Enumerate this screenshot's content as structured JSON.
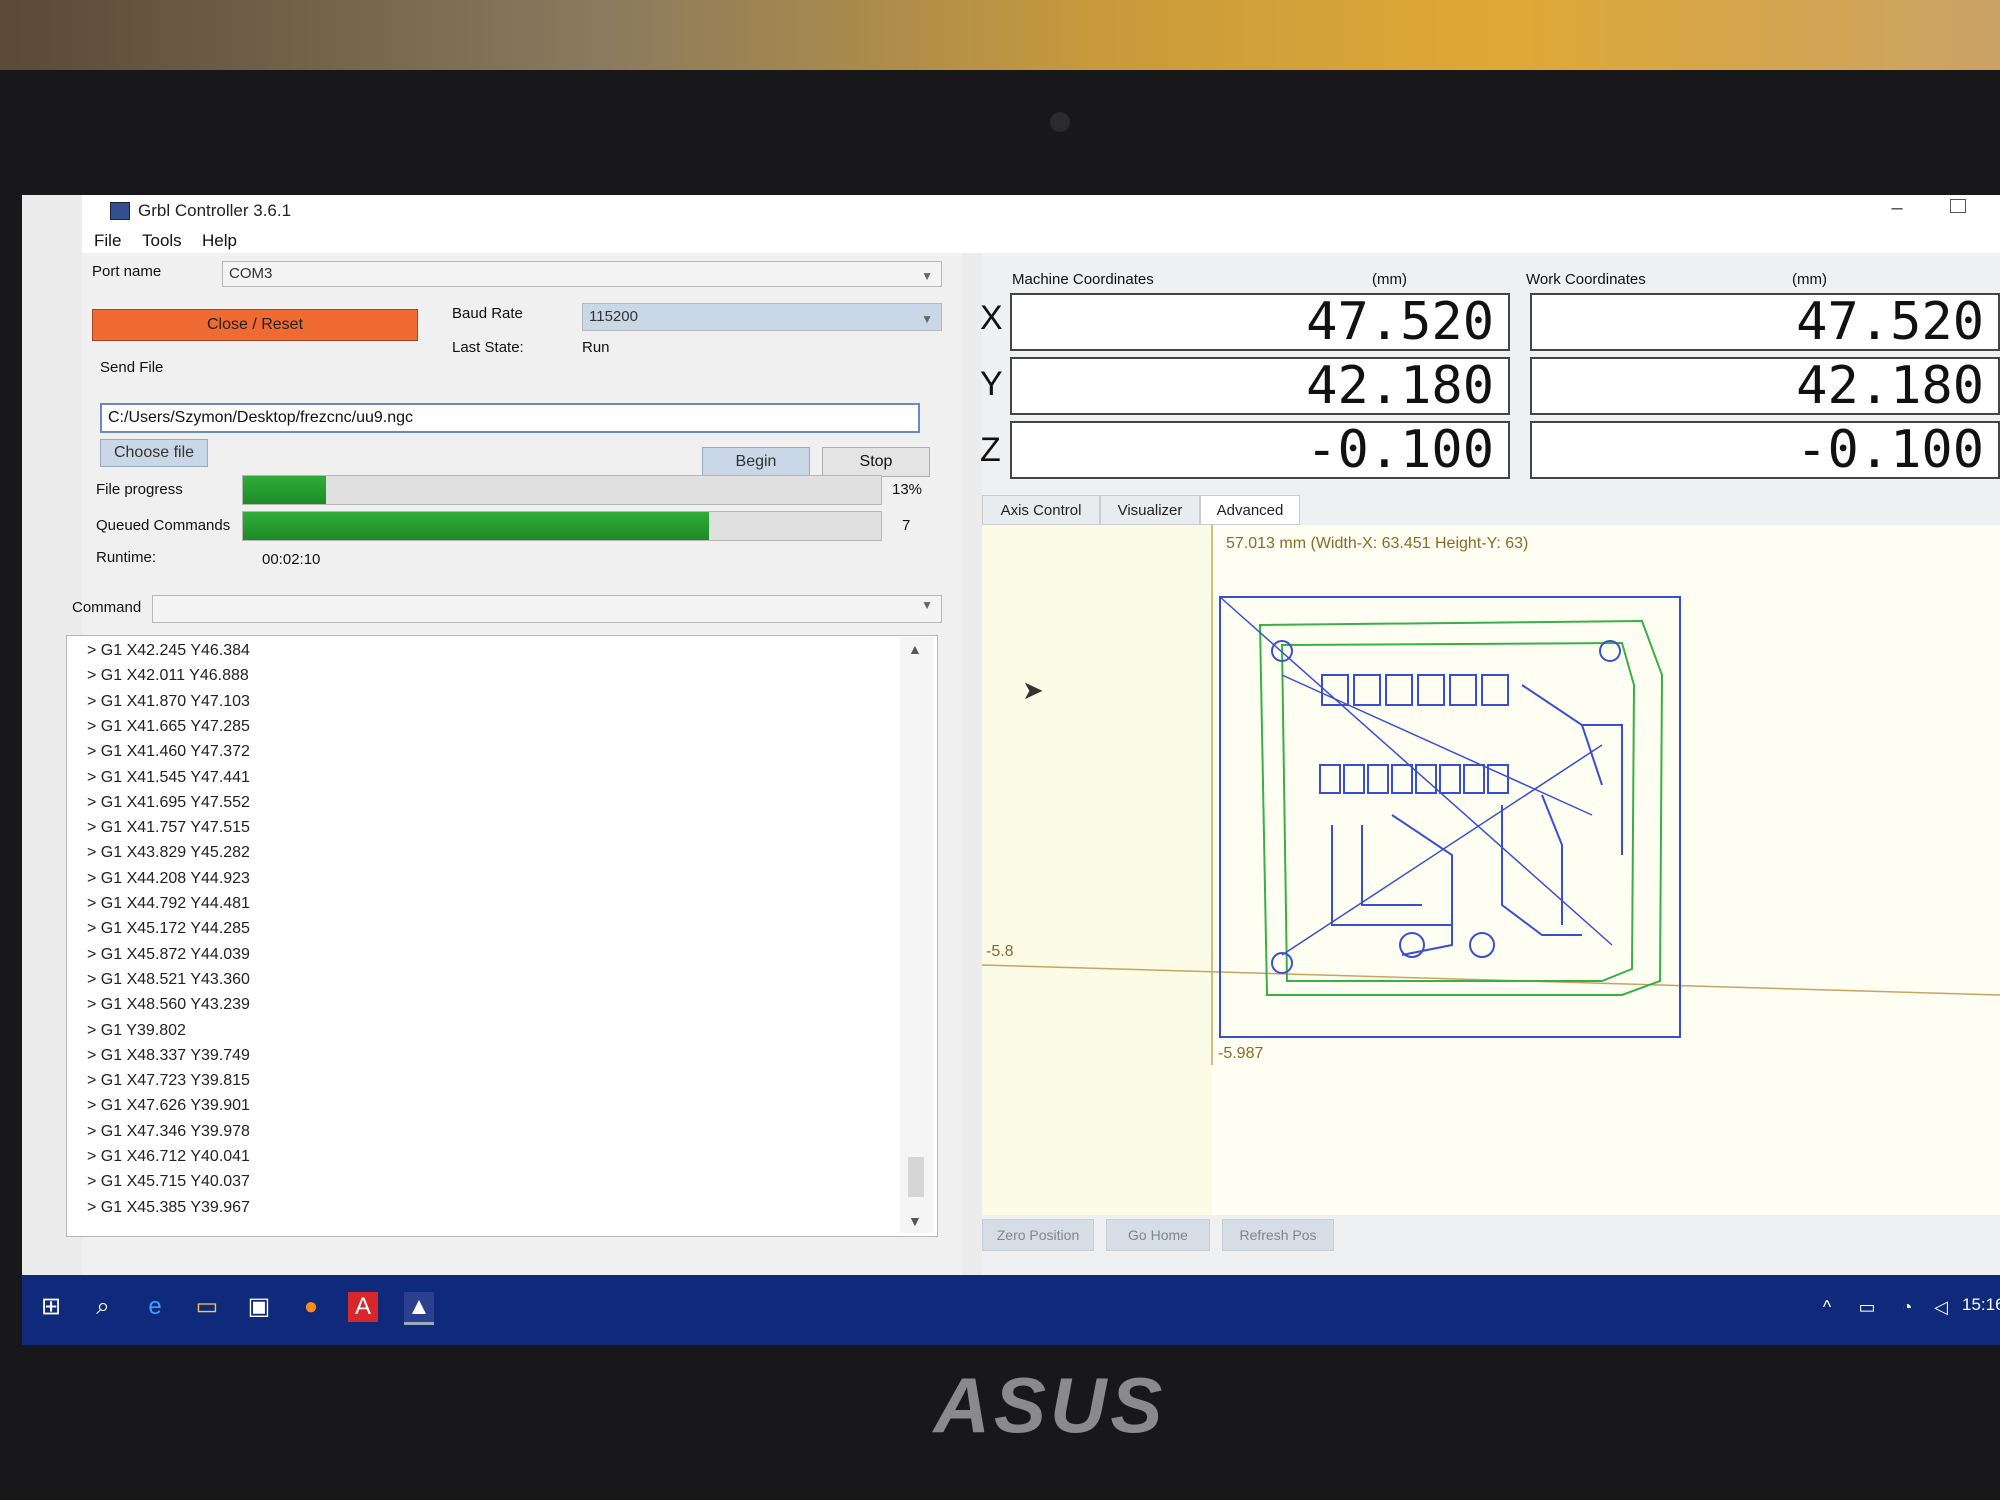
{
  "window": {
    "title": "Grbl Controller 3.6.1"
  },
  "menu": [
    "File",
    "Tools",
    "Help"
  ],
  "connection": {
    "port_label": "Port name",
    "port_value": "COM3",
    "close_button": "Close / Reset",
    "baud_label": "Baud Rate",
    "baud_value": "115200",
    "last_state_label": "Last State:",
    "last_state_value": "Run"
  },
  "send_file": {
    "label": "Send File",
    "path": "C:/Users/Szymon/Desktop/frezcnc/uu9.ngc",
    "choose_button": "Choose file",
    "begin_button": "Begin",
    "stop_button": "Stop",
    "file_progress_label": "File progress",
    "file_progress_percent": 13,
    "file_progress_text": "13%",
    "queued_label": "Queued Commands",
    "queued_fraction": 0.73,
    "queued_count": "7",
    "runtime_label": "Runtime:",
    "runtime_value": "00:02:10"
  },
  "command": {
    "label": "Command"
  },
  "log": [
    "> G1 X42.245 Y46.384",
    "> G1 X42.011 Y46.888",
    "> G1 X41.870 Y47.103",
    "> G1 X41.665 Y47.285",
    "> G1 X41.460 Y47.372",
    "> G1 X41.545 Y47.441",
    "> G1 X41.695 Y47.552",
    "> G1 X41.757 Y47.515",
    "> G1 X43.829 Y45.282",
    "> G1 X44.208 Y44.923",
    "> G1 X44.792 Y44.481",
    "> G1 X45.172 Y44.285",
    "> G1 X45.872 Y44.039",
    "> G1 X48.521 Y43.360",
    "> G1 X48.560 Y43.239",
    "> G1 Y39.802",
    "> G1 X48.337 Y39.749",
    "> G1 X47.723 Y39.815",
    "> G1 X47.626 Y39.901",
    "> G1 X47.346 Y39.978",
    "> G1 X46.712 Y40.041",
    "> G1 X45.715 Y40.037",
    "> G1 X45.385 Y39.967"
  ],
  "coordinates": {
    "machine_label": "Machine Coordinates",
    "work_label": "Work Coordinates",
    "unit": "(mm)",
    "axes": [
      {
        "axis": "X",
        "machine": "47.520",
        "work": "47.520"
      },
      {
        "axis": "Y",
        "machine": "42.180",
        "work": "42.180"
      },
      {
        "axis": "Z",
        "machine": "-0.100",
        "work": "-0.100"
      }
    ]
  },
  "tabs": [
    "Axis Control",
    "Visualizer",
    "Advanced"
  ],
  "visualizer": {
    "info": "57.013 mm  (Width-X: 63.451  Height-Y: 63)",
    "x_origin_label": "-5.8",
    "y_origin_label": "-5.987"
  },
  "actions": [
    "Zero Position",
    "Go Home",
    "Refresh Pos"
  ],
  "taskbar": {
    "icons": [
      "windows-start-icon",
      "search-icon",
      "edge-icon",
      "file-explorer-icon",
      "store-icon",
      "firefox-icon",
      "acrobat-icon",
      "grbl-controller-icon"
    ],
    "time": "15:16"
  },
  "laptop_brand": "ASUS"
}
